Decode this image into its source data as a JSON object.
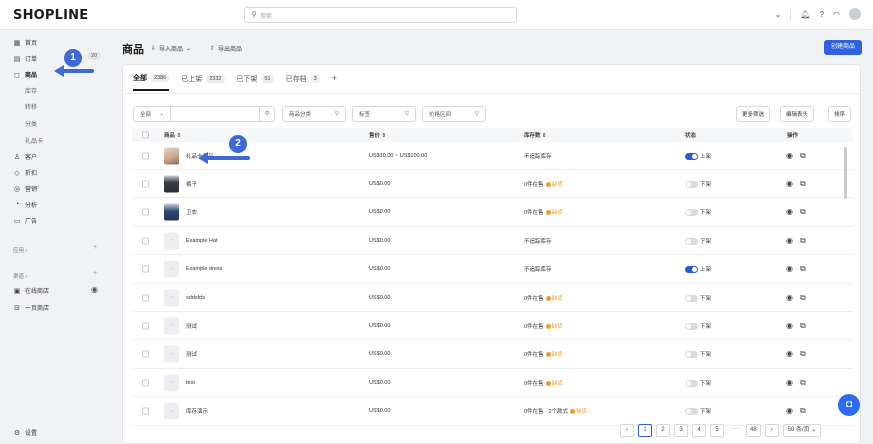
{
  "topbar": {
    "logo": "SHOPLINE",
    "search_placeholder": "搜索",
    "icons": [
      "chevron-down-icon",
      "bell-icon",
      "help-icon",
      "wifi-icon",
      "avatar"
    ]
  },
  "sidebar": {
    "items": [
      {
        "label": "首页",
        "icon": "home-icon"
      },
      {
        "label": "订单",
        "icon": "order-icon",
        "badge": "20"
      },
      {
        "label": "商品",
        "icon": "product-icon",
        "active": true
      },
      {
        "label": "客户",
        "icon": "user-icon"
      },
      {
        "label": "折扣",
        "icon": "tag-icon"
      },
      {
        "label": "营销",
        "icon": "marketing-icon"
      },
      {
        "label": "分析",
        "icon": "analytics-icon"
      },
      {
        "label": "广告",
        "icon": "ads-icon"
      }
    ],
    "sub_items": [
      "库存",
      "转移",
      "分类",
      "礼品卡"
    ],
    "apps_heading": "应用",
    "channels_heading": "渠道",
    "channels": [
      {
        "label": "在线商店",
        "icon": "store-icon"
      },
      {
        "label": "一页商店",
        "icon": "page-store-icon"
      }
    ],
    "settings": "设置"
  },
  "header": {
    "title": "商品",
    "import_label": "导入商品",
    "export_label": "导出商品",
    "create_label": "创建商品"
  },
  "tabs": [
    {
      "label": "全部",
      "count": "2386",
      "active": true
    },
    {
      "label": "已上架",
      "count": "2332"
    },
    {
      "label": "已下架",
      "count": "51"
    },
    {
      "label": "已存档",
      "count": "3"
    }
  ],
  "filters": {
    "scope": "全部",
    "category": "商品分类",
    "tag": "标签",
    "price": "价格区间",
    "more": "更多筛选",
    "edit_header": "编辑表头",
    "sort": "排序"
  },
  "columns": {
    "product": "商品",
    "price": "售价",
    "stock": "库存数",
    "status": "状态",
    "ops": "操作"
  },
  "rows": [
    {
      "name": "礼品卡商品",
      "price": "US$10.00 ~ US$100.00",
      "stock": "不追踪库存",
      "stock_warn": "",
      "status": "上架",
      "on": true,
      "thumb": "img1"
    },
    {
      "name": "裤子",
      "price": "US$0.00",
      "stock": "0件在售",
      "stock_warn": "缺货",
      "status": "下架",
      "on": false,
      "thumb": "img2"
    },
    {
      "name": "卫衣",
      "price": "US$0.00",
      "stock": "0件在售",
      "stock_warn": "缺货",
      "status": "下架",
      "on": false,
      "thumb": "img3"
    },
    {
      "name": "Example Hat",
      "price": "US$0.00",
      "stock": "不追踪库存",
      "stock_warn": "",
      "status": "下架",
      "on": false,
      "thumb": ""
    },
    {
      "name": "Example dress",
      "price": "US$0.00",
      "stock": "不追踪库存",
      "stock_warn": "",
      "status": "上架",
      "on": true,
      "thumb": ""
    },
    {
      "name": "sddsfds",
      "price": "US$0.00",
      "stock": "0件在售",
      "stock_warn": "缺货",
      "status": "下架",
      "on": false,
      "thumb": ""
    },
    {
      "name": "测试",
      "price": "US$0.00",
      "stock": "0件在售",
      "stock_warn": "缺货",
      "status": "下架",
      "on": false,
      "thumb": ""
    },
    {
      "name": "测试",
      "price": "US$0.00",
      "stock": "0件在售",
      "stock_warn": "缺货",
      "status": "下架",
      "on": false,
      "thumb": ""
    },
    {
      "name": "test",
      "price": "US$0.00",
      "stock": "0件在售",
      "stock_warn": "缺货",
      "status": "下架",
      "on": false,
      "thumb": ""
    },
    {
      "name": "库存演示",
      "price": "US$0.00",
      "stock": "0件在售 · 2个款式",
      "stock_warn": "缺货",
      "status": "下架",
      "on": false,
      "thumb": ""
    }
  ],
  "pagination": {
    "pages": [
      "1",
      "2",
      "3",
      "4",
      "5",
      "···",
      "48"
    ],
    "current": "1",
    "page_size": "50 条/页"
  },
  "annotations": [
    "1",
    "2"
  ],
  "colors": {
    "primary": "#3061e0",
    "warn": "#f39c2a",
    "annotation": "#3d6ad6"
  }
}
